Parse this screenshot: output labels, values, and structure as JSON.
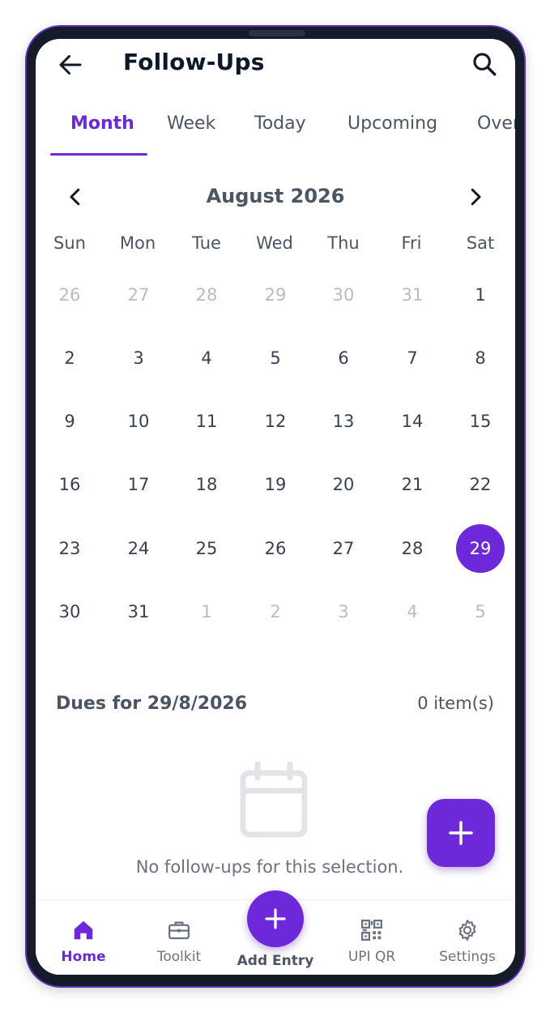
{
  "header": {
    "title": "Follow-Ups"
  },
  "tabs": [
    {
      "label": "Month",
      "active": true
    },
    {
      "label": "Week",
      "active": false
    },
    {
      "label": "Today",
      "active": false
    },
    {
      "label": "Upcoming",
      "active": false
    },
    {
      "label": "Overdue",
      "active": false
    }
  ],
  "calendar": {
    "month_label": "August 2026",
    "weekdays": [
      "Sun",
      "Mon",
      "Tue",
      "Wed",
      "Thu",
      "Fri",
      "Sat"
    ],
    "weeks": [
      [
        {
          "d": "26",
          "m": true
        },
        {
          "d": "27",
          "m": true
        },
        {
          "d": "28",
          "m": true
        },
        {
          "d": "29",
          "m": true
        },
        {
          "d": "30",
          "m": true
        },
        {
          "d": "31",
          "m": true
        },
        {
          "d": "1"
        }
      ],
      [
        {
          "d": "2"
        },
        {
          "d": "3"
        },
        {
          "d": "4"
        },
        {
          "d": "5"
        },
        {
          "d": "6"
        },
        {
          "d": "7"
        },
        {
          "d": "8"
        }
      ],
      [
        {
          "d": "9"
        },
        {
          "d": "10"
        },
        {
          "d": "11"
        },
        {
          "d": "12"
        },
        {
          "d": "13"
        },
        {
          "d": "14"
        },
        {
          "d": "15"
        }
      ],
      [
        {
          "d": "16"
        },
        {
          "d": "17"
        },
        {
          "d": "18"
        },
        {
          "d": "19"
        },
        {
          "d": "20"
        },
        {
          "d": "21"
        },
        {
          "d": "22"
        }
      ],
      [
        {
          "d": "23"
        },
        {
          "d": "24"
        },
        {
          "d": "25"
        },
        {
          "d": "26"
        },
        {
          "d": "27"
        },
        {
          "d": "28"
        },
        {
          "d": "29",
          "s": true
        }
      ],
      [
        {
          "d": "30"
        },
        {
          "d": "31"
        },
        {
          "d": "1",
          "m": true
        },
        {
          "d": "2",
          "m": true
        },
        {
          "d": "3",
          "m": true
        },
        {
          "d": "4",
          "m": true
        },
        {
          "d": "5",
          "m": true
        }
      ]
    ]
  },
  "dues": {
    "title": "Dues for 29/8/2026",
    "count": "0 item(s)",
    "empty_text": "No follow-ups for this selection."
  },
  "bottom_nav": {
    "items": [
      {
        "label": "Home",
        "icon": "home-icon",
        "active": true
      },
      {
        "label": "Toolkit",
        "icon": "toolkit-icon",
        "active": false
      },
      {
        "label": "UPI QR",
        "icon": "qr-code-icon",
        "active": false
      },
      {
        "label": "Settings",
        "icon": "settings-icon",
        "active": false
      }
    ],
    "center_label": "Add Entry"
  },
  "colors": {
    "accent": "#6d28d9",
    "text": "#4b5563",
    "muted": "#b7bcc4",
    "frame": "#161b2a"
  }
}
